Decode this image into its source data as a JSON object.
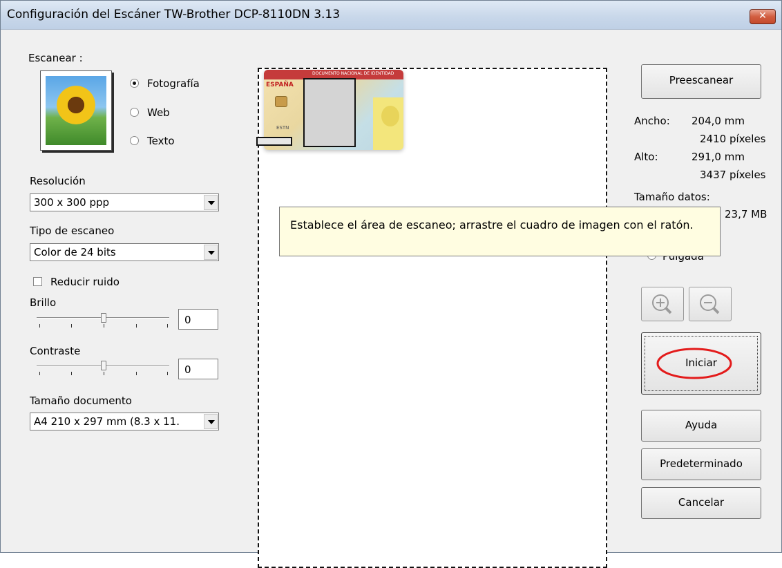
{
  "window": {
    "title": "Configuración del Escáner TW-Brother DCP-8110DN   3.13",
    "close_glyph": "✕"
  },
  "scan": {
    "label": "Escanear :",
    "thumbnail_icon": "sunflower-photo-icon",
    "options": [
      {
        "label": "Fotografía",
        "selected": true
      },
      {
        "label": "Web",
        "selected": false
      },
      {
        "label": "Texto",
        "selected": false
      }
    ]
  },
  "resolution": {
    "label": "Resolución",
    "value": "300 x 300 ppp"
  },
  "scan_type": {
    "label": "Tipo de escaneo",
    "value": "Color de 24 bits"
  },
  "noise_reduction": {
    "label": "Reducir ruido",
    "checked": false
  },
  "brightness": {
    "label": "Brillo",
    "value": "0"
  },
  "contrast": {
    "label": "Contraste",
    "value": "0"
  },
  "document_size": {
    "label": "Tamaño documento",
    "value": "A4 210 x 297 mm (8.3 x 11."
  },
  "preview": {
    "card_header": "DOCUMENTO NACIONAL DE IDENTIDAD",
    "card_country": "ESPAÑA",
    "card_code": "ESTN"
  },
  "tooltip": {
    "text": "Establece el área de escaneo; arrastre el cuadro de imagen con el ratón."
  },
  "info": {
    "width_label": "Ancho:",
    "width_mm": "204,0 mm",
    "width_px": "2410 píxeles",
    "height_label": "Alto:",
    "height_mm": "291,0 mm",
    "height_px": "3437 píxeles",
    "data_size_label": "Tamaño datos:",
    "data_size_value": "23,7 MB",
    "unit_option": "Pulgada"
  },
  "buttons": {
    "prescan": "Preescanear",
    "zoom_in_icon": "zoom-in-icon",
    "zoom_out_icon": "zoom-out-icon",
    "start": "Iniciar",
    "help": "Ayuda",
    "default": "Predeterminado",
    "cancel": "Cancelar"
  },
  "colors": {
    "highlight_circle": "#e31b1b",
    "title_bar": "#c9d8ea",
    "tooltip_bg": "#fffde1"
  }
}
